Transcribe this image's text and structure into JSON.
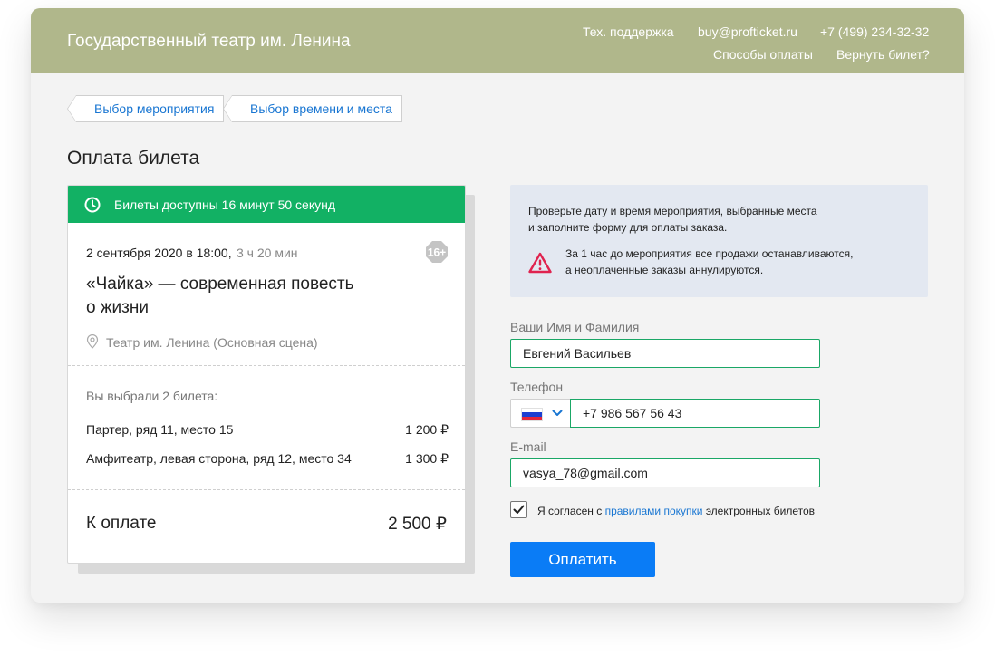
{
  "header": {
    "brand": "Государственный театр им. Ленина",
    "support": "Тех. поддержка",
    "email": "buy@profticket.ru",
    "phone": "+7 (499) 234-32-32",
    "payment_methods": "Способы оплаты",
    "return_ticket": "Вернуть билет?"
  },
  "breadcrumbs": [
    {
      "label": "Выбор мероприятия"
    },
    {
      "label": "Выбор времени и места"
    }
  ],
  "page_title": "Оплата билета",
  "order_card": {
    "timer_text": "Билеты доступны 16 минут 50 секунд",
    "date": "2 сентября 2020 в 18:00,",
    "duration": "3 ч 20 мин",
    "age_rating": "16+",
    "event_title_line1": "«Чайка» — современная повесть",
    "event_title_line2": "о жизни",
    "venue": "Театр им. Ленина (Основная сцена)",
    "chosen_label": "Вы выбрали 2 билета:",
    "tickets": [
      {
        "seat": "Партер, ряд 11, место 15",
        "price": "1 200 ₽"
      },
      {
        "seat": "Амфитеатр, левая сторона, ряд 12, место 34",
        "price": "1 300 ₽"
      }
    ],
    "total_label": "К оплате",
    "total_value": "2 500 ₽"
  },
  "info_box": {
    "line1": "Проверьте дату и время мероприятия, выбранные места",
    "line2": "и заполните форму  для оплаты заказа.",
    "warning_line1": "За 1 час до мероприятия все продажи останавливаются,",
    "warning_line2": "а неоплаченные заказы аннулируются."
  },
  "form": {
    "name_label": "Ваши Имя и Фамилия",
    "name_value": "Евгений Васильев",
    "phone_label": "Телефон",
    "phone_value": "+7 986 567 56 43",
    "email_label": "E-mail",
    "email_value": "vasya_78@gmail.com",
    "agree_prefix": "Я согласен с ",
    "agree_link": "правилами покупки",
    "agree_suffix": " электронных билетов",
    "agree_checked": true,
    "submit_label": "Оплатить"
  },
  "colors": {
    "header_bg": "#b0b78b",
    "timer_green": "#12b164",
    "accent_blue": "#0a7cf6",
    "link_blue": "#1976d2",
    "input_border": "#1aa766",
    "warning_red": "#e0234f",
    "info_bg": "#e3e8f1"
  },
  "icons": {
    "timer": "clock-icon",
    "age": "age-badge-icon",
    "venue": "location-pin-icon",
    "warning": "warning-triangle-icon",
    "country": "russia-flag-icon",
    "dropdown": "chevron-down-icon",
    "agree": "checkmark-icon"
  }
}
